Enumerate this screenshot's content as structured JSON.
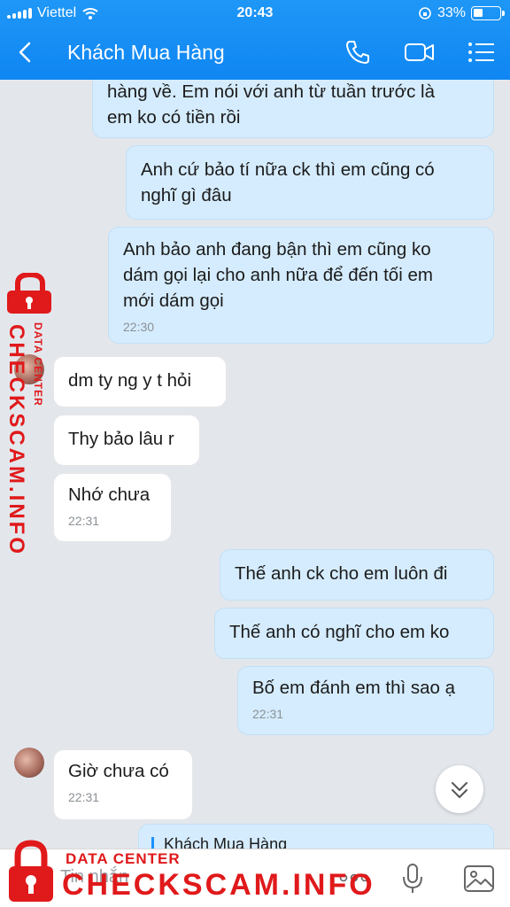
{
  "status": {
    "carrier": "Viettel",
    "time": "20:43",
    "battery": "33%"
  },
  "header": {
    "title": "Khách Mua Hàng"
  },
  "messages": [
    {
      "side": "me",
      "text": "hàng về. Em nói với anh từ tuần trước là\nem ko có tiền rồi"
    },
    {
      "side": "me",
      "text": "Anh cứ bảo tí nữa ck thì em cũng có\nnghĩ gì đâu"
    },
    {
      "side": "me",
      "text": "Anh bảo anh đang bận thì em cũng ko\ndám gọi lại cho anh nữa để đến tối em\nmới dám gọi",
      "time": "22:30"
    },
    {
      "side": "them",
      "text": "dm ty ng y t hỏi"
    },
    {
      "side": "them",
      "text": "Thy bảo lâu r"
    },
    {
      "side": "them",
      "text": "Nhớ chưa",
      "time": "22:31"
    },
    {
      "side": "me",
      "text": "Thế anh ck cho em luôn đi"
    },
    {
      "side": "me",
      "text": "Thế anh có nghĩ cho em ko"
    },
    {
      "side": "me",
      "text": "Bố em đánh em thì sao ạ",
      "time": "22:31"
    },
    {
      "side": "them",
      "text": "Giờ chưa có",
      "time": "22:31"
    }
  ],
  "reply_preview": {
    "name": "Khách Mua Hàng"
  },
  "input": {
    "placeholder": "Tin nhắn"
  },
  "watermark": {
    "small": "DATA CENTER",
    "big": "CHECKSCAM.INFO"
  },
  "icons": [
    "back-icon",
    "phone-icon",
    "video-call-icon",
    "menu-icon",
    "scroll-down-icon",
    "more-icon",
    "microphone-icon",
    "image-icon",
    "lock-icon"
  ],
  "colors": {
    "header": "#1a8ff5",
    "my_bubble": "#d5ecfe",
    "their_bubble": "#ffffff",
    "watermark": "#e0191b"
  }
}
